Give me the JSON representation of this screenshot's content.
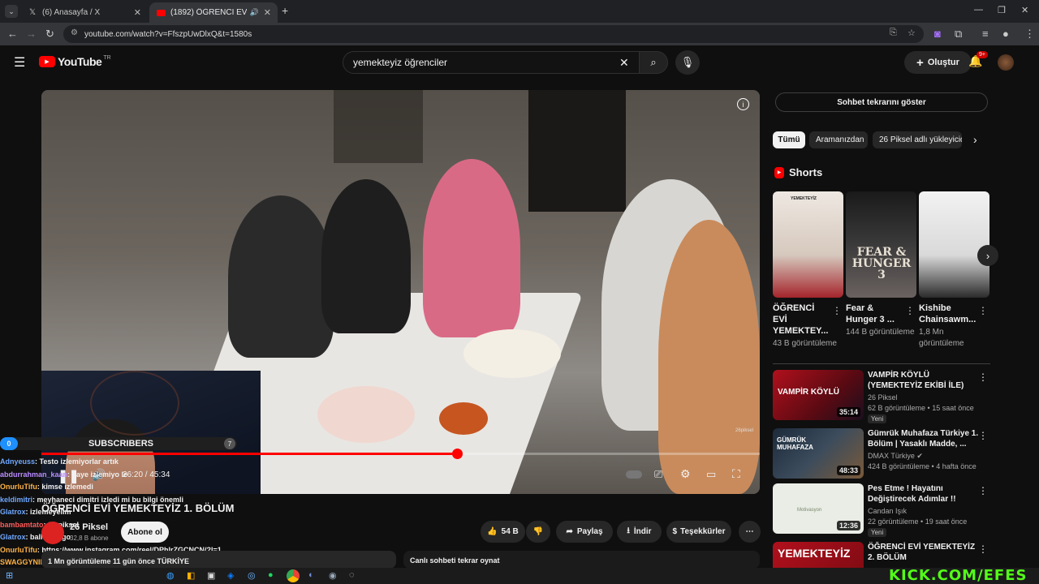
{
  "browser": {
    "tabs": [
      {
        "label": "(6) Anasayfa / X",
        "icon": "x-logo-icon"
      },
      {
        "label": "(1892) ÖĞRENCİ EVİ YEMEKTEYİZ",
        "icon": "youtube-icon"
      }
    ],
    "url": "youtube.com/watch?v=FfszpUwDlxQ&t=1580s"
  },
  "youtube": {
    "logo_text": "YouTube",
    "region": "TR",
    "search_value": "yemekteyiz öğrenciler",
    "create_label": "Oluştur",
    "notif_count": "9+"
  },
  "player": {
    "time_current": "26:20",
    "time_total": "45:34",
    "progress": 0.578,
    "watermark": "26piksel"
  },
  "subs_overlay": {
    "left_num": "0",
    "label": "SUBSCRIBERS",
    "right_num": "7"
  },
  "chat": [
    {
      "user": "Adnyeuss",
      "msg": ": Testo izlemiyorlar artık",
      "color": "#6fa8ff"
    },
    {
      "user": "abdurrahman_kaan",
      "msg": ": daye izlemiyo le",
      "color": "#b98cff"
    },
    {
      "user": "OnurluTifu",
      "msg": ": kimse izlemedi",
      "color": "#ffb347"
    },
    {
      "user": "keldimitri",
      "msg": ": meyhaneci dimitri izledi mi bu bilgi önemli",
      "color": "#6fa8ff"
    },
    {
      "user": "Glatrox",
      "msg": ": izlemeyelim",
      "color": "#6fa8ff"
    },
    {
      "user": "bambamtato",
      "msg": ": 26 piksel",
      "color": "#ff5a5a"
    },
    {
      "user": "Glatrox",
      "msg": ": ball x pit go",
      "color": "#6fa8ff"
    },
    {
      "user": "OnurluTifu",
      "msg": ": https://www.instagram.com/reel/DPhlrZGCNCN/?l=1",
      "color": "#ffb347"
    },
    {
      "user": "SWAGGYNIN_KUCUK_CEO",
      "msg": ": izlemeyelim videonun sesi bozuk zaten",
      "color": "#ffb347"
    },
    {
      "user": "Bambychiato",
      "msg": ": ne gel birlikte izleyelim",
      "color": "#ff5a5a"
    }
  ],
  "video": {
    "title": "ÖĞRENCİ EVİ YEMEKTEYİZ 1. BÖLÜM",
    "channel": "26 Piksel",
    "subscribers": "32,8 B abone",
    "subscribe_label": "Abone ol",
    "likes": "54 B",
    "share_label": "Paylaş",
    "download_label": "İndir",
    "thanks_label": "Teşekkürler",
    "views_line": "1 Mn görüntüleme  11 gün önce  TÜRKİYE",
    "chat_replay_bottom": "Canlı sohbeti tekrar oynat"
  },
  "sidebar": {
    "chat_replay_btn": "Sohbet tekrarını göster",
    "chips": [
      "Tümü",
      "Aramanızdan",
      "26 Piksel adlı yükleyiciden"
    ],
    "shorts_heading": "Shorts",
    "shorts": [
      {
        "title": "ÖĞRENCİ EVİ YEMEKTEY...",
        "views": "43 B görüntüleme",
        "thumb_text": "YEMEKTEYİZ"
      },
      {
        "title": "Fear & Hunger 3 ...",
        "views": "144 B görüntüleme",
        "thumb_text": "FEAR & HUNGER 3"
      },
      {
        "title": "Kishibe Chainsawm...",
        "views": "1,8 Mn görüntüleme",
        "thumb_text": ""
      }
    ],
    "recs": [
      {
        "title": "VAMPİR KÖYLÜ (YEMEKTEYİZ EKİBİ İLE)",
        "channel": "26 Piksel",
        "meta": "62 B görüntüleme • 15 saat önce",
        "badge": "Yeni",
        "duration": "35:14",
        "thumb_text": "VAMPİR KÖYLÜ"
      },
      {
        "title": "Gümrük Muhafaza Türkiye 1. Bölüm | Yasaklı Madde, ...",
        "channel": "DMAX Türkiye",
        "meta": "424 B görüntüleme • 4 hafta önce",
        "badge": "",
        "duration": "48:33",
        "thumb_text": "GÜMRÜK MUHAFAZA"
      },
      {
        "title": "Pes Etme ! Hayatını Değiştirecek Adımlar !!",
        "channel": "Candan Işık",
        "meta": "22 görüntüleme • 19 saat önce",
        "badge": "Yeni",
        "duration": "12:36",
        "thumb_text": "Motivasyon"
      },
      {
        "title": "ÖĞRENCİ EVİ YEMEKTEYİZ 2. BÖLÜM",
        "channel": "26 Piksel",
        "meta": "",
        "badge": "",
        "duration": "",
        "thumb_text": "YEMEKTEYİZ"
      }
    ]
  },
  "overlay_brand": "KICK.COM/EFES",
  "colors": {
    "yt_red": "#ff0000",
    "kick_green": "#53fc18",
    "bg": "#0f0f0f"
  }
}
